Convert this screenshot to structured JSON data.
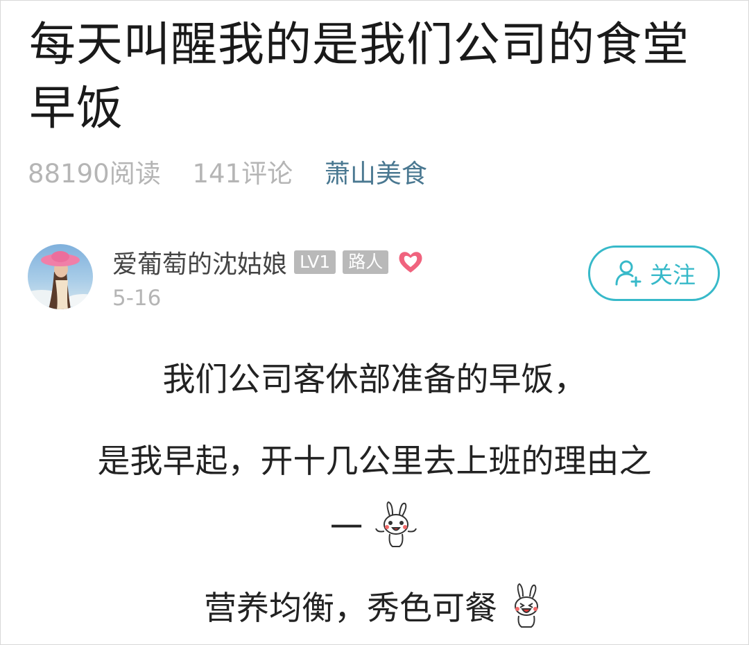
{
  "post": {
    "title": "每天叫醒我的是我们公司的食堂早饭",
    "reads": "88190阅读",
    "comments": "141评论",
    "topic": "萧山美食"
  },
  "author": {
    "name": "爱葡萄的沈姑娘",
    "level_badge": "LV1",
    "role_badge": "路人",
    "date": "5-16",
    "follow_label": "关注"
  },
  "content": {
    "line1": "我们公司客休部准备的早饭，",
    "line2": "是我早起，开十几公里去上班的理由之",
    "line3": "一",
    "line4": "营养均衡，秀色可餐"
  },
  "colors": {
    "accent": "#37b9c9",
    "topic": "#4a7891",
    "muted": "#b5b5b5",
    "heart": "#f0637e"
  },
  "icons": {
    "follow": "add-user-icon",
    "heart": "heart-icon",
    "sticker": "rabbit-sticker"
  }
}
